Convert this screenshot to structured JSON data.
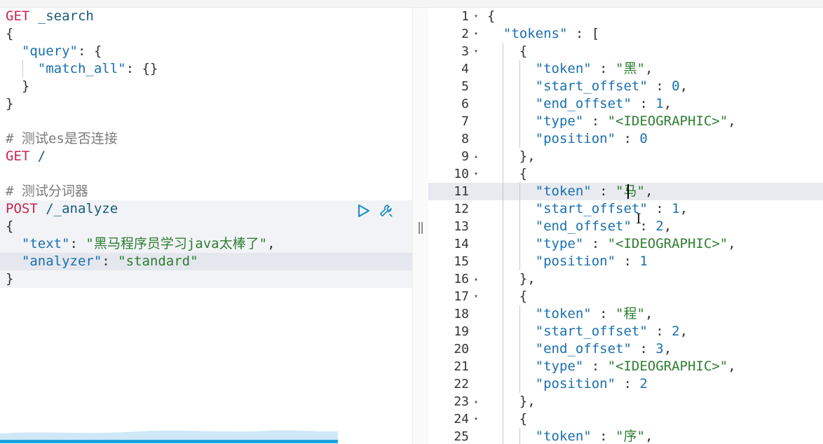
{
  "request_editor": {
    "lines": [
      {
        "segments": [
          {
            "t": "GET",
            "c": "method"
          },
          {
            "t": " _search",
            "c": "path"
          }
        ]
      },
      {
        "segments": [
          {
            "t": "{",
            "c": "punc"
          }
        ]
      },
      {
        "segments": [
          {
            "t": "  ",
            "c": "punc"
          },
          {
            "t": "\"query\"",
            "c": "key"
          },
          {
            "t": ": {",
            "c": "punc"
          }
        ]
      },
      {
        "segments": [
          {
            "t": "    ",
            "c": "punc"
          },
          {
            "t": "\"match_all\"",
            "c": "key"
          },
          {
            "t": ": {}",
            "c": "punc"
          }
        ]
      },
      {
        "segments": [
          {
            "t": "  }",
            "c": "punc"
          }
        ]
      },
      {
        "segments": [
          {
            "t": "}",
            "c": "punc"
          }
        ]
      },
      {
        "segments": []
      },
      {
        "segments": [
          {
            "t": "# 测试es是否连接",
            "c": "comment"
          }
        ]
      },
      {
        "segments": [
          {
            "t": "GET",
            "c": "method"
          },
          {
            "t": " /",
            "c": "path"
          }
        ]
      },
      {
        "segments": []
      },
      {
        "segments": [
          {
            "t": "# 测试分词器",
            "c": "comment"
          }
        ]
      },
      {
        "segments": [
          {
            "t": "POST",
            "c": "method"
          },
          {
            "t": " /_analyze",
            "c": "path"
          }
        ]
      },
      {
        "segments": [
          {
            "t": "{",
            "c": "punc"
          }
        ]
      },
      {
        "segments": [
          {
            "t": "  ",
            "c": "punc"
          },
          {
            "t": "\"text\"",
            "c": "key"
          },
          {
            "t": ": ",
            "c": "punc"
          },
          {
            "t": "\"黑马程序员学习java太棒了\"",
            "c": "str"
          },
          {
            "t": ",",
            "c": "punc"
          }
        ]
      },
      {
        "segments": [
          {
            "t": "  ",
            "c": "punc"
          },
          {
            "t": "\"analyzer\"",
            "c": "key"
          },
          {
            "t": ": ",
            "c": "punc"
          },
          {
            "t": "\"standard\"",
            "c": "str"
          }
        ]
      },
      {
        "segments": [
          {
            "t": "}",
            "c": "punc"
          }
        ]
      }
    ],
    "actions": {
      "run_icon": "play-icon",
      "settings_icon": "wrench-icon"
    }
  },
  "divider": {
    "grip": "‖"
  },
  "response_viewer": {
    "lines": [
      {
        "n": "1",
        "fold": "▾",
        "segments": [
          {
            "t": "{",
            "c": "punc"
          }
        ]
      },
      {
        "n": "2",
        "fold": "▾",
        "segments": [
          {
            "t": "  ",
            "c": "punc"
          },
          {
            "t": "\"tokens\"",
            "c": "key"
          },
          {
            "t": " : [",
            "c": "punc"
          }
        ]
      },
      {
        "n": "3",
        "fold": "▾",
        "segments": [
          {
            "t": "    {",
            "c": "punc"
          }
        ]
      },
      {
        "n": "4",
        "fold": "",
        "segments": [
          {
            "t": "      ",
            "c": "punc"
          },
          {
            "t": "\"token\"",
            "c": "key"
          },
          {
            "t": " : ",
            "c": "punc"
          },
          {
            "t": "\"黑\"",
            "c": "str"
          },
          {
            "t": ",",
            "c": "punc"
          }
        ]
      },
      {
        "n": "5",
        "fold": "",
        "segments": [
          {
            "t": "      ",
            "c": "punc"
          },
          {
            "t": "\"start_offset\"",
            "c": "key"
          },
          {
            "t": " : ",
            "c": "punc"
          },
          {
            "t": "0",
            "c": "num"
          },
          {
            "t": ",",
            "c": "punc"
          }
        ]
      },
      {
        "n": "6",
        "fold": "",
        "segments": [
          {
            "t": "      ",
            "c": "punc"
          },
          {
            "t": "\"end_offset\"",
            "c": "key"
          },
          {
            "t": " : ",
            "c": "punc"
          },
          {
            "t": "1",
            "c": "num"
          },
          {
            "t": ",",
            "c": "punc"
          }
        ]
      },
      {
        "n": "7",
        "fold": "",
        "segments": [
          {
            "t": "      ",
            "c": "punc"
          },
          {
            "t": "\"type\"",
            "c": "key"
          },
          {
            "t": " : ",
            "c": "punc"
          },
          {
            "t": "\"<IDEOGRAPHIC>\"",
            "c": "str"
          },
          {
            "t": ",",
            "c": "punc"
          }
        ]
      },
      {
        "n": "8",
        "fold": "",
        "segments": [
          {
            "t": "      ",
            "c": "punc"
          },
          {
            "t": "\"position\"",
            "c": "key"
          },
          {
            "t": " : ",
            "c": "punc"
          },
          {
            "t": "0",
            "c": "num"
          }
        ]
      },
      {
        "n": "9",
        "fold": "▴",
        "segments": [
          {
            "t": "    },",
            "c": "punc"
          }
        ]
      },
      {
        "n": "10",
        "fold": "▾",
        "segments": [
          {
            "t": "    {",
            "c": "punc"
          }
        ]
      },
      {
        "n": "11",
        "fold": "",
        "segments": [
          {
            "t": "      ",
            "c": "punc"
          },
          {
            "t": "\"token\"",
            "c": "key"
          },
          {
            "t": " : ",
            "c": "punc"
          },
          {
            "t": "\"马\"",
            "c": "str"
          },
          {
            "t": ",",
            "c": "punc"
          }
        ]
      },
      {
        "n": "12",
        "fold": "",
        "segments": [
          {
            "t": "      ",
            "c": "punc"
          },
          {
            "t": "\"start_offset\"",
            "c": "key"
          },
          {
            "t": " : ",
            "c": "punc"
          },
          {
            "t": "1",
            "c": "num"
          },
          {
            "t": ",",
            "c": "punc"
          }
        ]
      },
      {
        "n": "13",
        "fold": "",
        "segments": [
          {
            "t": "      ",
            "c": "punc"
          },
          {
            "t": "\"end_offset\"",
            "c": "key"
          },
          {
            "t": " : ",
            "c": "punc"
          },
          {
            "t": "2",
            "c": "num"
          },
          {
            "t": ",",
            "c": "punc"
          }
        ]
      },
      {
        "n": "14",
        "fold": "",
        "segments": [
          {
            "t": "      ",
            "c": "punc"
          },
          {
            "t": "\"type\"",
            "c": "key"
          },
          {
            "t": " : ",
            "c": "punc"
          },
          {
            "t": "\"<IDEOGRAPHIC>\"",
            "c": "str"
          },
          {
            "t": ",",
            "c": "punc"
          }
        ]
      },
      {
        "n": "15",
        "fold": "",
        "segments": [
          {
            "t": "      ",
            "c": "punc"
          },
          {
            "t": "\"position\"",
            "c": "key"
          },
          {
            "t": " : ",
            "c": "punc"
          },
          {
            "t": "1",
            "c": "num"
          }
        ]
      },
      {
        "n": "16",
        "fold": "▴",
        "segments": [
          {
            "t": "    },",
            "c": "punc"
          }
        ]
      },
      {
        "n": "17",
        "fold": "▾",
        "segments": [
          {
            "t": "    {",
            "c": "punc"
          }
        ]
      },
      {
        "n": "18",
        "fold": "",
        "segments": [
          {
            "t": "      ",
            "c": "punc"
          },
          {
            "t": "\"token\"",
            "c": "key"
          },
          {
            "t": " : ",
            "c": "punc"
          },
          {
            "t": "\"程\"",
            "c": "str"
          },
          {
            "t": ",",
            "c": "punc"
          }
        ]
      },
      {
        "n": "19",
        "fold": "",
        "segments": [
          {
            "t": "      ",
            "c": "punc"
          },
          {
            "t": "\"start_offset\"",
            "c": "key"
          },
          {
            "t": " : ",
            "c": "punc"
          },
          {
            "t": "2",
            "c": "num"
          },
          {
            "t": ",",
            "c": "punc"
          }
        ]
      },
      {
        "n": "20",
        "fold": "",
        "segments": [
          {
            "t": "      ",
            "c": "punc"
          },
          {
            "t": "\"end_offset\"",
            "c": "key"
          },
          {
            "t": " : ",
            "c": "punc"
          },
          {
            "t": "3",
            "c": "num"
          },
          {
            "t": ",",
            "c": "punc"
          }
        ]
      },
      {
        "n": "21",
        "fold": "",
        "segments": [
          {
            "t": "      ",
            "c": "punc"
          },
          {
            "t": "\"type\"",
            "c": "key"
          },
          {
            "t": " : ",
            "c": "punc"
          },
          {
            "t": "\"<IDEOGRAPHIC>\"",
            "c": "str"
          },
          {
            "t": ",",
            "c": "punc"
          }
        ]
      },
      {
        "n": "22",
        "fold": "",
        "segments": [
          {
            "t": "      ",
            "c": "punc"
          },
          {
            "t": "\"position\"",
            "c": "key"
          },
          {
            "t": " : ",
            "c": "punc"
          },
          {
            "t": "2",
            "c": "num"
          }
        ]
      },
      {
        "n": "23",
        "fold": "▴",
        "segments": [
          {
            "t": "    },",
            "c": "punc"
          }
        ]
      },
      {
        "n": "24",
        "fold": "▾",
        "segments": [
          {
            "t": "    {",
            "c": "punc"
          }
        ]
      },
      {
        "n": "25",
        "fold": "",
        "segments": [
          {
            "t": "      ",
            "c": "punc"
          },
          {
            "t": "\"token\"",
            "c": "key"
          },
          {
            "t": " : ",
            "c": "punc"
          },
          {
            "t": "\"序\"",
            "c": "str"
          },
          {
            "t": ",",
            "c": "punc"
          }
        ]
      }
    ]
  },
  "colors": {
    "accent": "#1aa3e0",
    "method": "#c7254e",
    "key": "#1a6fb0",
    "string": "#2e7d32"
  }
}
